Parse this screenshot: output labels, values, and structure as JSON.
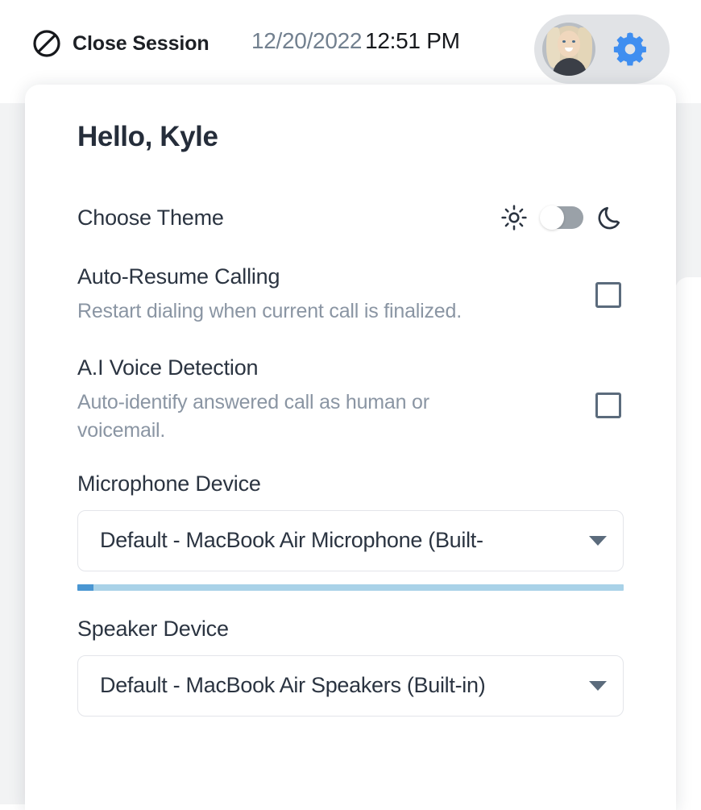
{
  "topbar": {
    "close_session_label": "Close Session",
    "close_session_icon": "prohibition-icon",
    "date": "12/20/2022",
    "time": "12:51 PM",
    "avatar_icon": "user-avatar",
    "gear_icon": "gear-icon",
    "gear_color": "#3f8ef0"
  },
  "panel": {
    "greeting": "Hello, Kyle",
    "theme": {
      "label": "Choose Theme",
      "light_icon": "sun-icon",
      "dark_icon": "moon-icon",
      "toggle_state": "light",
      "toggle_track_color": "#9aa1a8",
      "toggle_knob_color": "#ffffff"
    },
    "auto_resume": {
      "title": "Auto-Resume Calling",
      "description": "Restart dialing when current call is finalized.",
      "checked": false
    },
    "ai_voice": {
      "title": "A.I Voice Detection",
      "description": "Auto-identify answered call as human or voicemail.",
      "checked": false
    },
    "microphone": {
      "label": "Microphone Device",
      "selected": "Default - MacBook Air Microphone (Built-",
      "caret_icon": "chevron-down-icon",
      "level_percent": 3,
      "level_track_color": "#a9d2e8",
      "level_fill_color": "#4a96d2"
    },
    "speaker": {
      "label": "Speaker Device",
      "selected": "Default - MacBook Air Speakers (Built-in)",
      "caret_icon": "chevron-down-icon"
    }
  }
}
